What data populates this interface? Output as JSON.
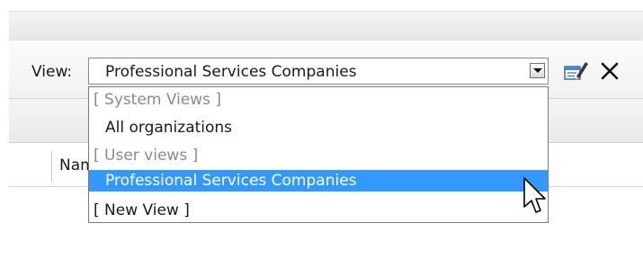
{
  "toolbar": {
    "view_label": "View:",
    "selected_view": "Professional Services Companies",
    "icons": [
      "dropdown-arrow-icon",
      "edit-view-icon",
      "delete-view-icon"
    ]
  },
  "grid": {
    "column_header": "Name"
  },
  "dropdown": {
    "options": [
      {
        "label": "[ System Views ]",
        "kind": "group-header"
      },
      {
        "label": "All organizations",
        "kind": "option"
      },
      {
        "label": "[ User views ]",
        "kind": "group-header"
      },
      {
        "label": "Professional Services Companies",
        "kind": "option",
        "selected": true
      },
      {
        "label": "[ New View ]",
        "kind": "action"
      }
    ]
  },
  "colors": {
    "highlight": "#3399ff",
    "group_header_text": "#8a8a8a"
  }
}
